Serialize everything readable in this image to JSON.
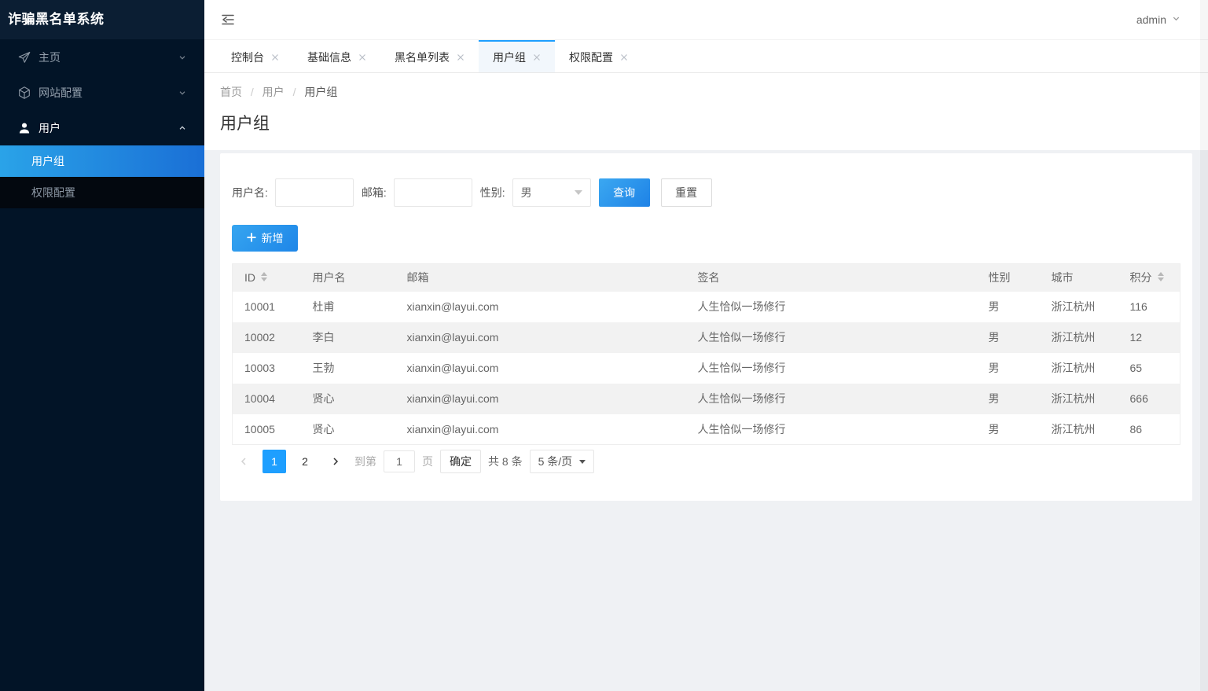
{
  "app": {
    "title": "诈骗黑名单系统",
    "user": "admin"
  },
  "colors": {
    "accent": "#1e9fff",
    "button_gradient": [
      "#3ba8f1",
      "#1e82e6"
    ],
    "sidebar_bg": "#021427",
    "sidebar_submenu_bg": "#03080f",
    "active_menu_gradient": [
      "#2aa3e8",
      "#1a6fd6"
    ],
    "table_header_bg": "#f2f2f2",
    "content_bg": "#eff1f4"
  },
  "header": {
    "collapse_icon": "collapse-menu-icon",
    "user_caret_icon": "chevron-down-icon"
  },
  "sidebar": {
    "items": [
      {
        "label": "主页",
        "icon": "paper-plane-icon",
        "state": "collapsed"
      },
      {
        "label": "网站配置",
        "icon": "cube-icon",
        "state": "collapsed"
      },
      {
        "label": "用户",
        "icon": "user-icon",
        "state": "expanded",
        "children": [
          {
            "label": "用户组",
            "active": true
          },
          {
            "label": "权限配置",
            "active": false
          }
        ]
      }
    ]
  },
  "tabs": [
    {
      "label": "控制台",
      "active": false
    },
    {
      "label": "基础信息",
      "active": false
    },
    {
      "label": "黑名单列表",
      "active": false
    },
    {
      "label": "用户组",
      "active": true
    },
    {
      "label": "权限配置",
      "active": false
    }
  ],
  "breadcrumb": {
    "items": [
      "首页",
      "用户",
      "用户组"
    ],
    "separator": "/"
  },
  "page": {
    "title": "用户组"
  },
  "search_form": {
    "username_label": "用户名:",
    "username_value": "",
    "email_label": "邮箱:",
    "email_value": "",
    "gender_label": "性别:",
    "gender_value": "男",
    "search_button": "查询",
    "reset_button": "重置",
    "add_button": "新增"
  },
  "table": {
    "columns": [
      "ID",
      "用户名",
      "邮箱",
      "签名",
      "性别",
      "城市",
      "积分"
    ],
    "sortable_columns": [
      "ID",
      "积分"
    ],
    "rows": [
      [
        "10001",
        "杜甫",
        "xianxin@layui.com",
        "人生恰似一场修行",
        "男",
        "浙江杭州",
        "116"
      ],
      [
        "10002",
        "李白",
        "xianxin@layui.com",
        "人生恰似一场修行",
        "男",
        "浙江杭州",
        "12"
      ],
      [
        "10003",
        "王勃",
        "xianxin@layui.com",
        "人生恰似一场修行",
        "男",
        "浙江杭州",
        "65"
      ],
      [
        "10004",
        "贤心",
        "xianxin@layui.com",
        "人生恰似一场修行",
        "男",
        "浙江杭州",
        "666"
      ],
      [
        "10005",
        "贤心",
        "xianxin@layui.com",
        "人生恰似一场修行",
        "男",
        "浙江杭州",
        "86"
      ]
    ]
  },
  "pagination": {
    "pages": [
      "1",
      "2"
    ],
    "current": "1",
    "goto_label": "到第",
    "goto_value": "1",
    "page_unit": "页",
    "confirm_button": "确定",
    "total_text": "共 8 条",
    "page_size": "5 条/页"
  }
}
